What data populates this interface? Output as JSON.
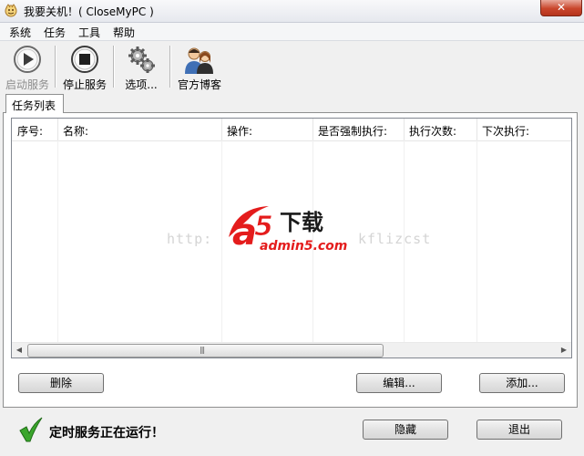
{
  "window": {
    "title": "我要关机！( CloseMyPC )",
    "close_glyph": "✕"
  },
  "menu": {
    "items": [
      "系统",
      "任务",
      "工具",
      "帮助"
    ]
  },
  "toolbar": {
    "start_label": "启动服务",
    "stop_label": "停止服务",
    "options_label": "选项...",
    "blog_label": "官方博客"
  },
  "tabs": {
    "active_label": "任务列表"
  },
  "task_list": {
    "columns": [
      "序号:",
      "名称:",
      "操作:",
      "是否强制执行:",
      "执行次数:",
      "下次执行:"
    ],
    "rows": []
  },
  "scrollbar": {
    "left_arrow": "◀",
    "right_arrow": "▶",
    "grip": "|||"
  },
  "buttons": {
    "delete_label": "删除",
    "edit_label": "编辑...",
    "add_label": "添加...",
    "hide_label": "隐藏",
    "exit_label": "退出"
  },
  "status": {
    "text": "定时服务正在运行！",
    "check_color": "#3aa62c"
  },
  "watermark": {
    "logo_letter": "a",
    "logo_digit": "5",
    "logo_cn": "下载",
    "logo_domain": "admin5.com",
    "url_left": "http:",
    "url_right": "kflizcst"
  },
  "colors": {
    "close_red": "#c9462c",
    "logo_red": "#e41c1c"
  }
}
